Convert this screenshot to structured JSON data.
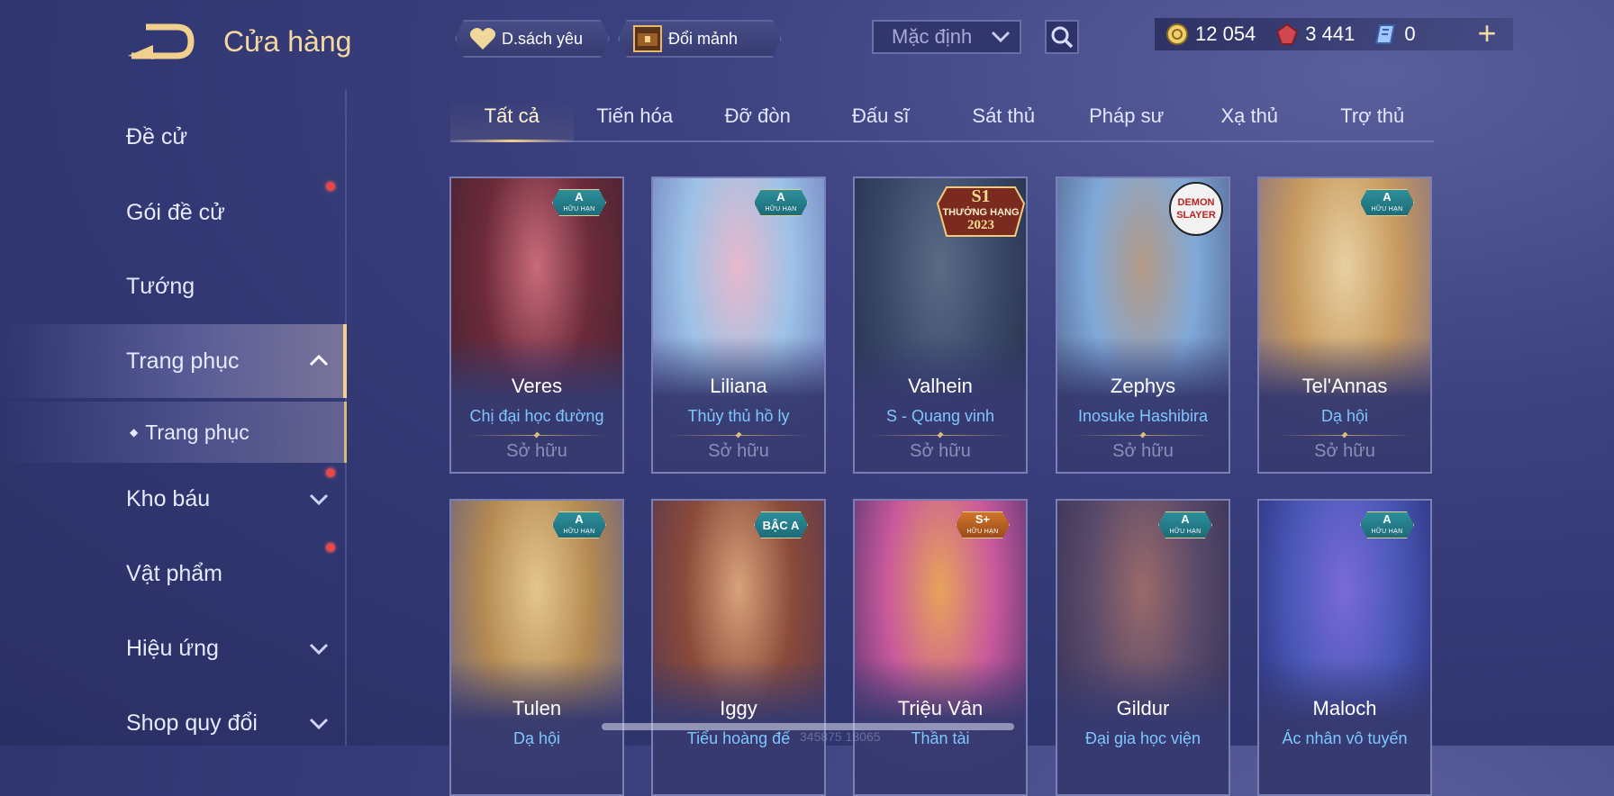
{
  "header": {
    "title": "Cửa hàng",
    "favorites_label": "D.sách yêu",
    "fragments_label": "Đổi mảnh",
    "sort": {
      "selected": "Mặc định"
    },
    "currency": [
      {
        "icon": "gold-coin-icon",
        "value": "12 054"
      },
      {
        "icon": "red-gem-icon",
        "value": "3 441"
      },
      {
        "icon": "voucher-icon",
        "value": "0"
      }
    ],
    "plus": "+"
  },
  "sidebar": {
    "items": [
      {
        "label": "Đề cử"
      },
      {
        "label": "Gói đề cử"
      },
      {
        "label": "Tướng"
      },
      {
        "label": "Trang phục"
      },
      {
        "label": "Trang phục"
      },
      {
        "label": "Kho báu"
      },
      {
        "label": "Vật phẩm"
      },
      {
        "label": "Hiệu ứng"
      },
      {
        "label": "Shop quy đổi"
      }
    ]
  },
  "tabs": [
    "Tất cả",
    "Tiến hóa",
    "Đỡ đòn",
    "Đấu sĩ",
    "Sát thủ",
    "Pháp sư",
    "Xạ thủ",
    "Trợ thủ"
  ],
  "cards": [
    {
      "hero": "Veres",
      "skin": "Chị đại học đường",
      "status": "Sở hữu",
      "badge": "A",
      "badge_sub": "HỮU HẠN",
      "colors": [
        "#6b2a3a",
        "#c96b7a",
        "#3e2230"
      ]
    },
    {
      "hero": "Liliana",
      "skin": "Thủy thủ hồ ly",
      "status": "Sở hữu",
      "badge": "A",
      "badge_sub": "HỮU HẠN",
      "colors": [
        "#9cc2e6",
        "#e7b9cd",
        "#6a73b8"
      ]
    },
    {
      "hero": "Valhein",
      "skin": "S - Quang vinh",
      "status": "Sở hữu",
      "badge_lines": [
        "S1",
        "THƯỞNG HẠNG",
        "2023"
      ],
      "colors": [
        "#3b4a6a",
        "#5a6b86",
        "#202a44"
      ]
    },
    {
      "hero": "Zephys",
      "skin": "Inosuke Hashibira",
      "status": "Sở hữu",
      "badge_text": "DEMON SLAYER",
      "colors": [
        "#7fa9d9",
        "#b49a86",
        "#4a5682"
      ]
    },
    {
      "hero": "Tel'Annas",
      "skin": "Dạ hội",
      "status": "Sở hữu",
      "badge": "A",
      "badge_sub": "HỮU HẠN",
      "colors": [
        "#c79a5e",
        "#e8d0a3",
        "#7a6a8c"
      ]
    },
    {
      "hero": "Tulen",
      "skin": "Dạ hội",
      "badge": "A",
      "badge_sub": "HỮU HẠN",
      "colors": [
        "#b48a52",
        "#e4c68d",
        "#5d5a88"
      ]
    },
    {
      "hero": "Iggy",
      "skin": "Tiểu hoàng đế",
      "badge": "BẬC A",
      "colors": [
        "#8a4a3a",
        "#d8a27a",
        "#4e3452"
      ]
    },
    {
      "hero": "Triệu Vân",
      "skin": "Thần tài",
      "badge": "S+",
      "badge_sub": "HỮU HẠN",
      "colors": [
        "#c9599b",
        "#e7a35a",
        "#3d2d6a"
      ]
    },
    {
      "hero": "Gildur",
      "skin": "Đại gia học viện",
      "badge": "A",
      "badge_sub": "HỮU HẠN",
      "colors": [
        "#5a4a6a",
        "#9a6a6a",
        "#2e2c52"
      ]
    },
    {
      "hero": "Maloch",
      "skin": "Ác nhân vô tuyến",
      "badge": "A",
      "badge_sub": "HỮU HẠN",
      "colors": [
        "#4a58b8",
        "#7a6ad8",
        "#23286a"
      ]
    }
  ],
  "watermark": "345875 18065"
}
